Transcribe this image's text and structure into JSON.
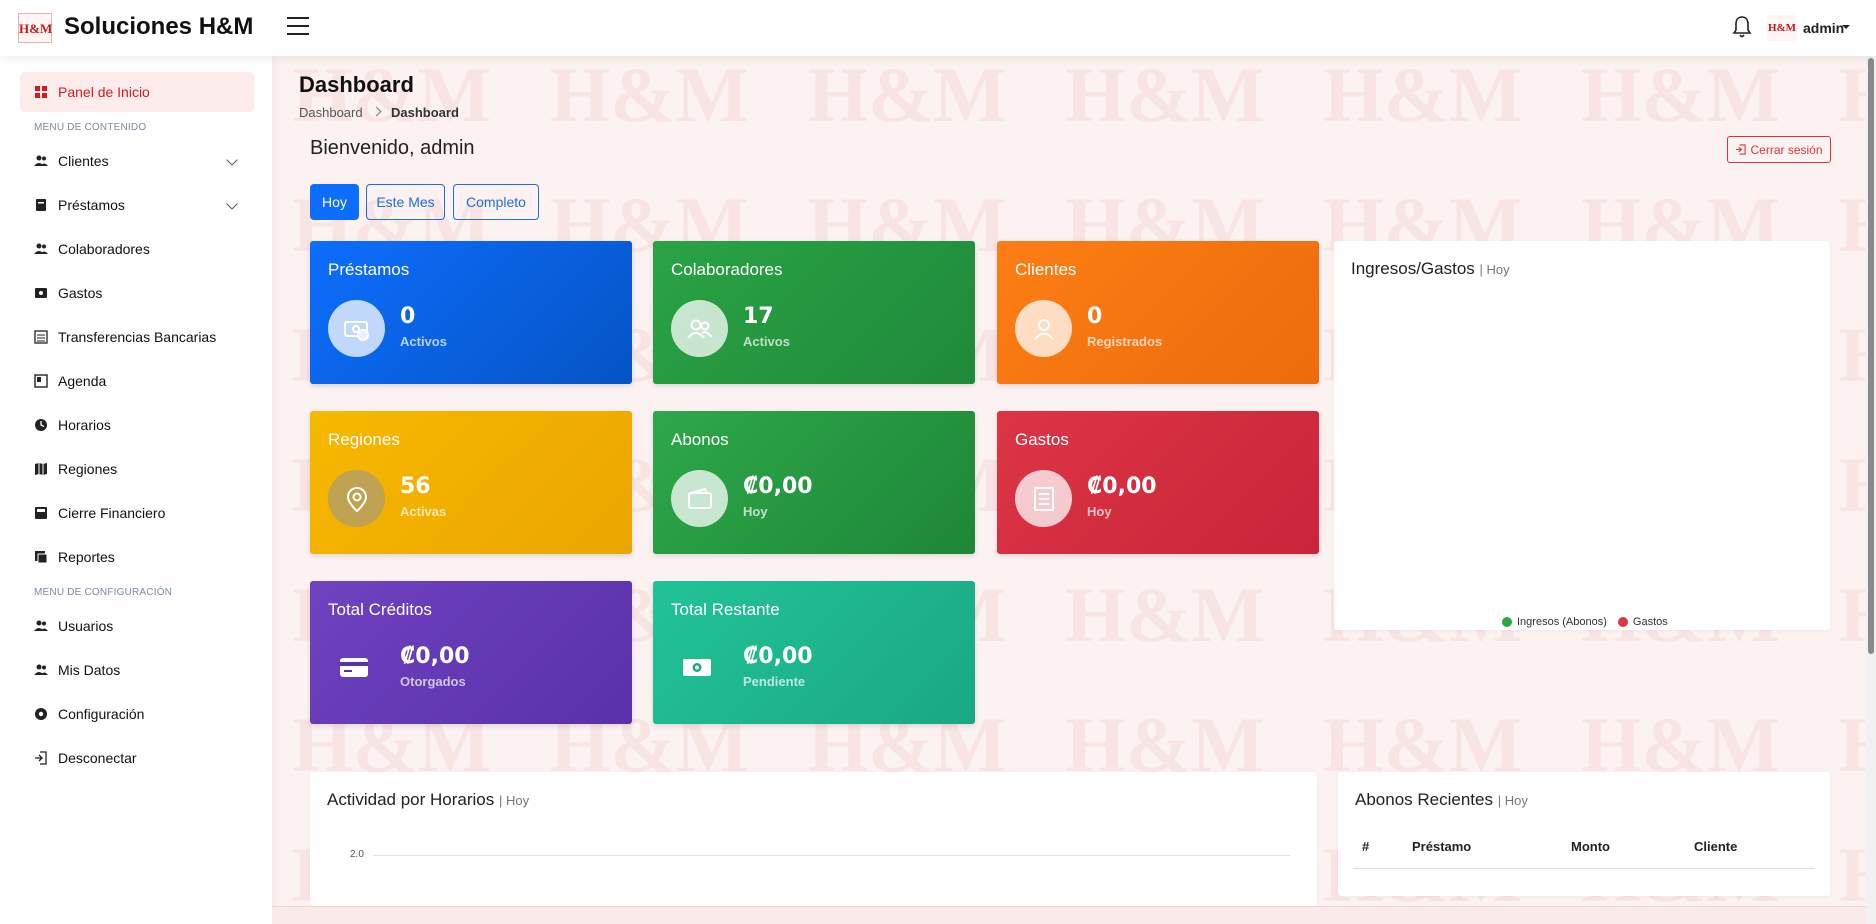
{
  "header": {
    "logo_text": "H&M",
    "brand": "Soluciones H&M",
    "user": "admin",
    "avatar_text": "H&M"
  },
  "sidebar": {
    "active_item": "Panel de Inicio",
    "heading_content": "MENU DE CONTENIDO",
    "items_content": [
      {
        "label": "Clientes",
        "icon": "users-icon",
        "expandable": true
      },
      {
        "label": "Préstamos",
        "icon": "loan-icon",
        "expandable": true
      },
      {
        "label": "Colaboradores",
        "icon": "users-icon"
      },
      {
        "label": "Gastos",
        "icon": "expense-icon"
      },
      {
        "label": "Transferencias Bancarias",
        "icon": "transfer-icon"
      },
      {
        "label": "Agenda",
        "icon": "calendar-icon"
      },
      {
        "label": "Horarios",
        "icon": "clock-icon"
      },
      {
        "label": "Regiones",
        "icon": "map-icon"
      },
      {
        "label": "Cierre Financiero",
        "icon": "folder-icon"
      },
      {
        "label": "Reportes",
        "icon": "report-icon"
      }
    ],
    "heading_config": "MENU DE CONFIGURACIÓN",
    "items_config": [
      {
        "label": "Usuarios",
        "icon": "users-icon"
      },
      {
        "label": "Mis Datos",
        "icon": "users-icon"
      },
      {
        "label": "Configuración",
        "icon": "gear-icon"
      },
      {
        "label": "Desconectar",
        "icon": "logout-icon"
      }
    ]
  },
  "page": {
    "title": "Dashboard",
    "breadcrumb": [
      "Dashboard",
      "Dashboard"
    ],
    "welcome": "Bienvenido, admin",
    "logout_label": "Cerrar sesión",
    "filters": [
      "Hoy",
      "Este Mes",
      "Completo"
    ],
    "active_filter": "Hoy"
  },
  "cards": [
    {
      "title": "Préstamos",
      "value": "0",
      "sub": "Activos",
      "color": "#0d6efd",
      "icon": "money-icon"
    },
    {
      "title": "Colaboradores",
      "value": "17",
      "sub": "Activos",
      "color": "#28a745",
      "icon": "users-icon"
    },
    {
      "title": "Clientes",
      "value": "0",
      "sub": "Registrados",
      "color": "#fd7e14",
      "icon": "user-icon"
    },
    {
      "title": "Regiones",
      "value": "56",
      "sub": "Activas",
      "color": "#f5b301",
      "icon": "location-icon"
    },
    {
      "title": "Abonos",
      "value": "₡0,00",
      "sub": "Hoy",
      "color": "#239b3f",
      "icon": "wallet-icon"
    },
    {
      "title": "Gastos",
      "value": "₡0,00",
      "sub": "Hoy",
      "color": "#dc3545",
      "icon": "receipt-icon"
    },
    {
      "title": "Total Créditos",
      "value": "₡0,00",
      "sub": "Otorgados",
      "color": "#6f42c1",
      "icon": "credit-card-icon"
    },
    {
      "title": "Total Restante",
      "value": "₡0,00",
      "sub": "Pendiente",
      "color": "#20c997",
      "icon": "cash-icon"
    }
  ],
  "panels": {
    "income": {
      "title": "Ingresos/Gastos",
      "sub": "| Hoy",
      "legend": [
        "Ingresos (Abonos)",
        "Gastos"
      ],
      "legend_colors": [
        "#28a745",
        "#dc3545"
      ]
    },
    "activity": {
      "title": "Actividad por Horarios",
      "sub": "| Hoy",
      "y_tick": "2.0"
    },
    "recent": {
      "title": "Abonos Recientes",
      "sub": "| Hoy",
      "columns": [
        "#",
        "Préstamo",
        "Monto",
        "Cliente"
      ]
    }
  }
}
